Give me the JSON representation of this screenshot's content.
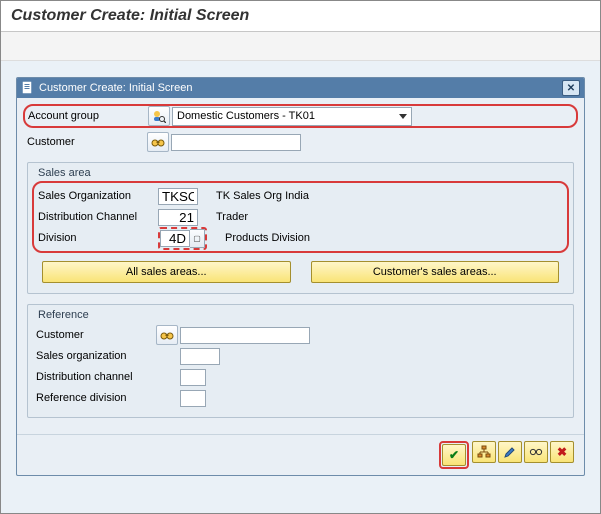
{
  "page_title": "Customer Create: Initial Screen",
  "dialog": {
    "title": "Customer Create: Initial Screen",
    "account_group": {
      "label": "Account group",
      "value": "Domestic Customers - TK01"
    },
    "customer": {
      "label": "Customer",
      "value": ""
    },
    "sales_area": {
      "title": "Sales area",
      "sales_org": {
        "label": "Sales Organization",
        "value": "TKSO",
        "desc": "TK Sales Org India"
      },
      "dist_channel": {
        "label": "Distribution Channel",
        "value": "21",
        "desc": "Trader"
      },
      "division": {
        "label": "Division",
        "value": "4D",
        "desc": "Products Division"
      },
      "all_sales_areas": "All sales areas...",
      "customer_sales_areas": "Customer's sales areas..."
    },
    "reference": {
      "title": "Reference",
      "customer": {
        "label": "Customer",
        "value": ""
      },
      "sales_org": {
        "label": "Sales organization",
        "value": ""
      },
      "dist_channel": {
        "label": "Distribution channel",
        "value": ""
      },
      "division": {
        "label": "Reference division",
        "value": ""
      }
    }
  }
}
